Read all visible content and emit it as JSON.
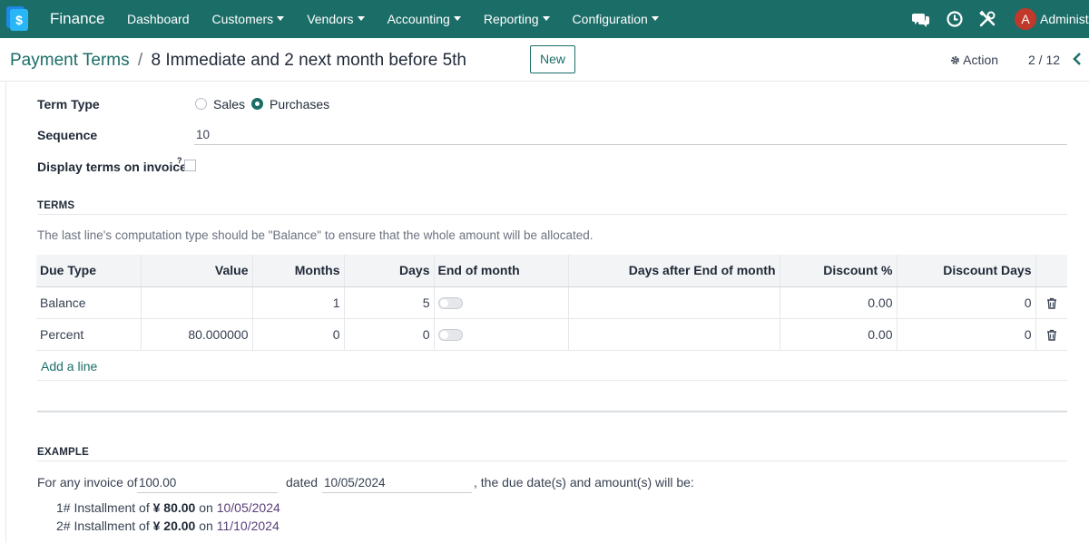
{
  "navbar": {
    "app_name": "Finance",
    "menu": [
      "Dashboard",
      "Customers",
      "Vendors",
      "Accounting",
      "Reporting",
      "Configuration"
    ],
    "avatar_letter": "A",
    "user_name": "Administrator",
    "icons": [
      "chat-icon",
      "clock-icon",
      "tools-icon"
    ],
    "bg_color": "#1b6d68"
  },
  "breadcrumb": {
    "parent": "Payment Terms",
    "separator": "/",
    "current": "8 Immediate and 2 next month before 5th"
  },
  "toolbar": {
    "new_label": "New",
    "action_label": "Action",
    "pager": "2 / 12"
  },
  "form": {
    "term_type_label": "Term Type",
    "term_type_options": [
      "Sales",
      "Purchases"
    ],
    "term_type_selected": "Purchases",
    "sequence_label": "Sequence",
    "sequence_value": "10",
    "display_terms_label": "Display terms on invoice",
    "display_terms_marker": "?",
    "display_terms_checked": false
  },
  "terms": {
    "title": "TERMS",
    "note": "The last line's computation type should be \"Balance\" to ensure that the whole amount will be allocated.",
    "columns": [
      "Due Type",
      "Value",
      "Months",
      "Days",
      "End of month",
      "Days after End of month",
      "Discount %",
      "Discount Days"
    ],
    "rows": [
      {
        "due_type": "Balance",
        "value": "",
        "months": "1",
        "days": "5",
        "end_of_month": false,
        "days_after": "",
        "discount_pct": "0.00",
        "discount_days": "0"
      },
      {
        "due_type": "Percent",
        "value": "80.000000",
        "months": "0",
        "days": "0",
        "end_of_month": false,
        "days_after": "",
        "discount_pct": "0.00",
        "discount_days": "0"
      }
    ],
    "add_line": "Add a line"
  },
  "example": {
    "title": "EXAMPLE",
    "prefix": "For any invoice of",
    "amount": "100.00",
    "dated_label": "dated",
    "date": "10/05/2024",
    "suffix": ", the due date(s) and amount(s) will be:",
    "installments": [
      {
        "index": "1#",
        "label": "Installment of",
        "amount": "¥ 80.00",
        "on": "on",
        "date": "10/05/2024"
      },
      {
        "index": "2#",
        "label": "Installment of",
        "amount": "¥ 20.00",
        "on": "on",
        "date": "11/10/2024"
      }
    ]
  }
}
